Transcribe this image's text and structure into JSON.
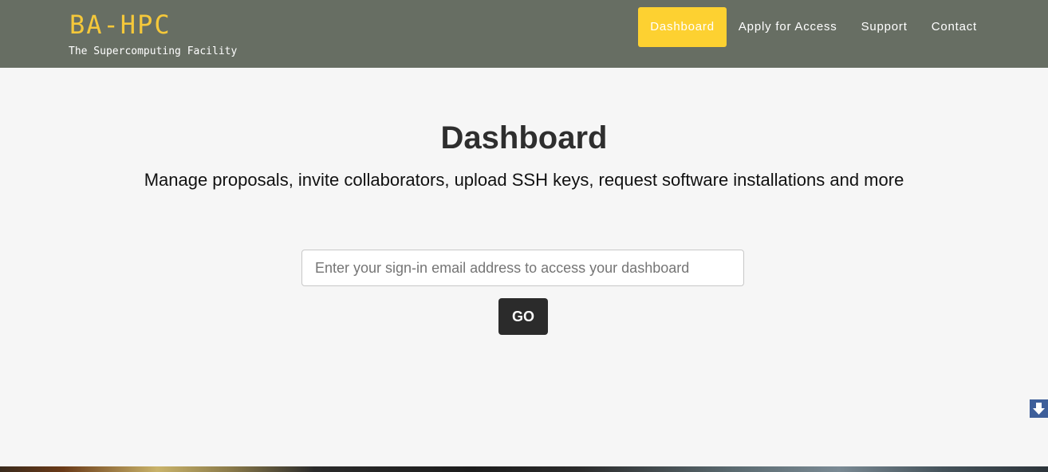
{
  "header": {
    "brand": "BA-HPC",
    "tagline": "The Supercomputing Facility",
    "nav": [
      {
        "label": "Dashboard",
        "active": true
      },
      {
        "label": "Apply for Access",
        "active": false
      },
      {
        "label": "Support",
        "active": false
      },
      {
        "label": "Contact",
        "active": false
      }
    ]
  },
  "main": {
    "title": "Dashboard",
    "subtitle": "Manage proposals, invite collaborators, upload SSH keys, request software installations and more",
    "email_placeholder": "Enter your sign-in email address to access your dashboard",
    "email_value": "",
    "go_label": "GO"
  },
  "colors": {
    "header_bg": "#676e63",
    "brand": "#f5c83a",
    "nav_active_bg": "#fdd131",
    "page_bg": "#f6f6f6",
    "button_bg": "#2b2b2b",
    "scroll_button_bg": "#3e5f9a"
  },
  "icons": {
    "scroll_down": "arrow-down-icon"
  }
}
